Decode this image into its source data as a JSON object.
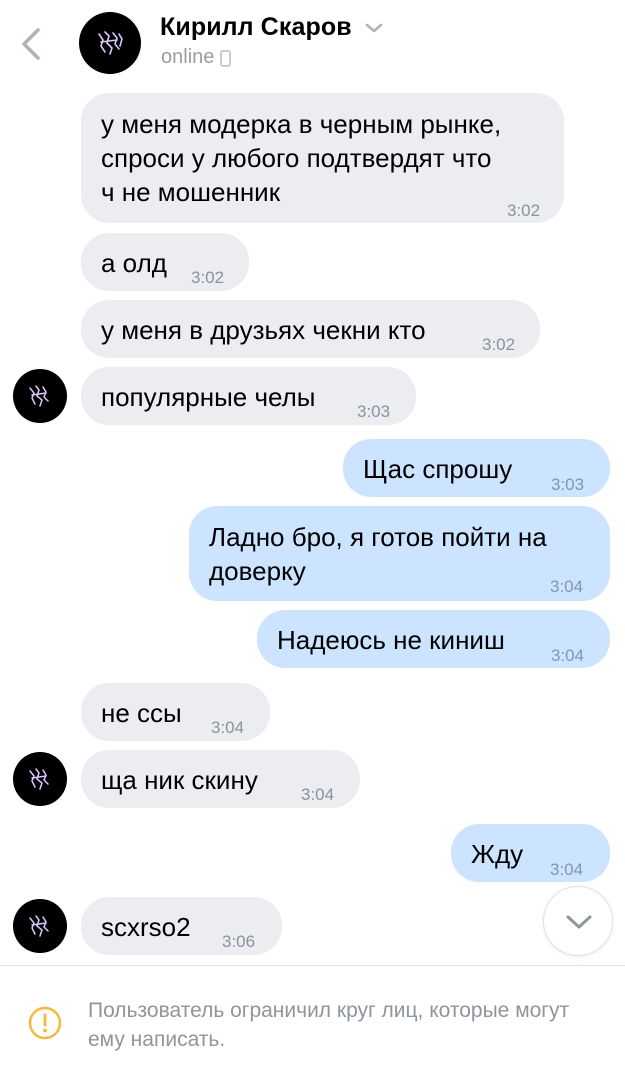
{
  "header": {
    "name": "Кирилл Скаров",
    "status": "online"
  },
  "messages": [
    {
      "text": "у меня модерка в черным рынке,\nспроси у любого подтвердят что\nч не мошенник",
      "time": "3:02"
    },
    {
      "text": "а олд",
      "time": "3:02"
    },
    {
      "text": "у меня в друзьях чекни кто",
      "time": "3:02"
    },
    {
      "text": "популярные челы",
      "time": "3:03"
    },
    {
      "text": "Щас спрошу",
      "time": "3:03"
    },
    {
      "text": "Ладно бро, я готов пойти на\nдоверку",
      "time": "3:04"
    },
    {
      "text": "Надеюсь не киниш",
      "time": "3:04"
    },
    {
      "text": "не ссы",
      "time": "3:04"
    },
    {
      "text": "ща ник скину",
      "time": "3:04"
    },
    {
      "text": "Жду",
      "time": "3:04"
    },
    {
      "text": "scxrso2",
      "time": "3:06"
    }
  ],
  "footer": {
    "notice": "Пользователь ограничил круг лиц, которые могут ему написать."
  },
  "colors": {
    "incoming_bubble": "#ebedf0",
    "outgoing_bubble": "#cce4ff",
    "notice_icon": "#f5b83d"
  },
  "icons": {
    "back": "chevron-left-icon",
    "title_menu": "chevron-down-icon",
    "mobile_status": "phone-icon",
    "scroll_down": "chevron-down-icon",
    "notice": "exclamation-circle-icon"
  }
}
